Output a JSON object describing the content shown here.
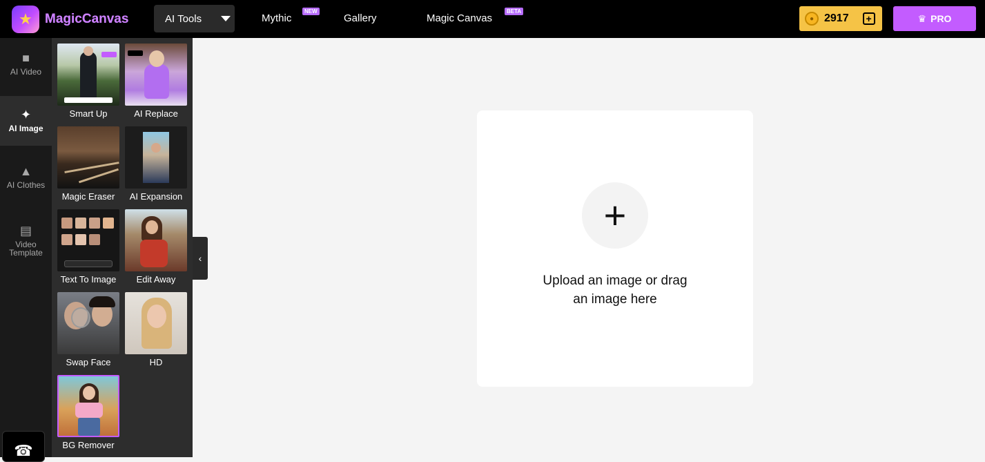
{
  "header": {
    "brand": "MagicCanvas",
    "tools_label": "AI Tools",
    "nav": [
      {
        "label": "Mythic",
        "badge": "NEW"
      },
      {
        "label": "Gallery",
        "badge": ""
      },
      {
        "label": "Magic Canvas",
        "badge": "BETA"
      }
    ],
    "coins": "2917",
    "pro_label": "PRO"
  },
  "rail": {
    "items": [
      {
        "label": "AI Video",
        "icon": "video-camera-icon"
      },
      {
        "label": "AI Image",
        "icon": "sparkle-icon"
      },
      {
        "label": "AI Clothes",
        "icon": "dress-icon"
      },
      {
        "label": "Video Template",
        "icon": "template-cards-icon"
      }
    ]
  },
  "tools": [
    {
      "label": "Smart Up"
    },
    {
      "label": "AI Replace"
    },
    {
      "label": "Magic Eraser"
    },
    {
      "label": "AI Expansion"
    },
    {
      "label": "Text To Image"
    },
    {
      "label": "Edit Away"
    },
    {
      "label": "Swap Face"
    },
    {
      "label": "HD"
    },
    {
      "label": "BG Remover"
    }
  ],
  "upload": {
    "line1": "Upload an image or drag",
    "line2": "an image here"
  },
  "colors": {
    "accent": "#c35cff",
    "coin_bg": "#f5c346",
    "topbar": "#000000",
    "panel": "#2d2d2d"
  }
}
